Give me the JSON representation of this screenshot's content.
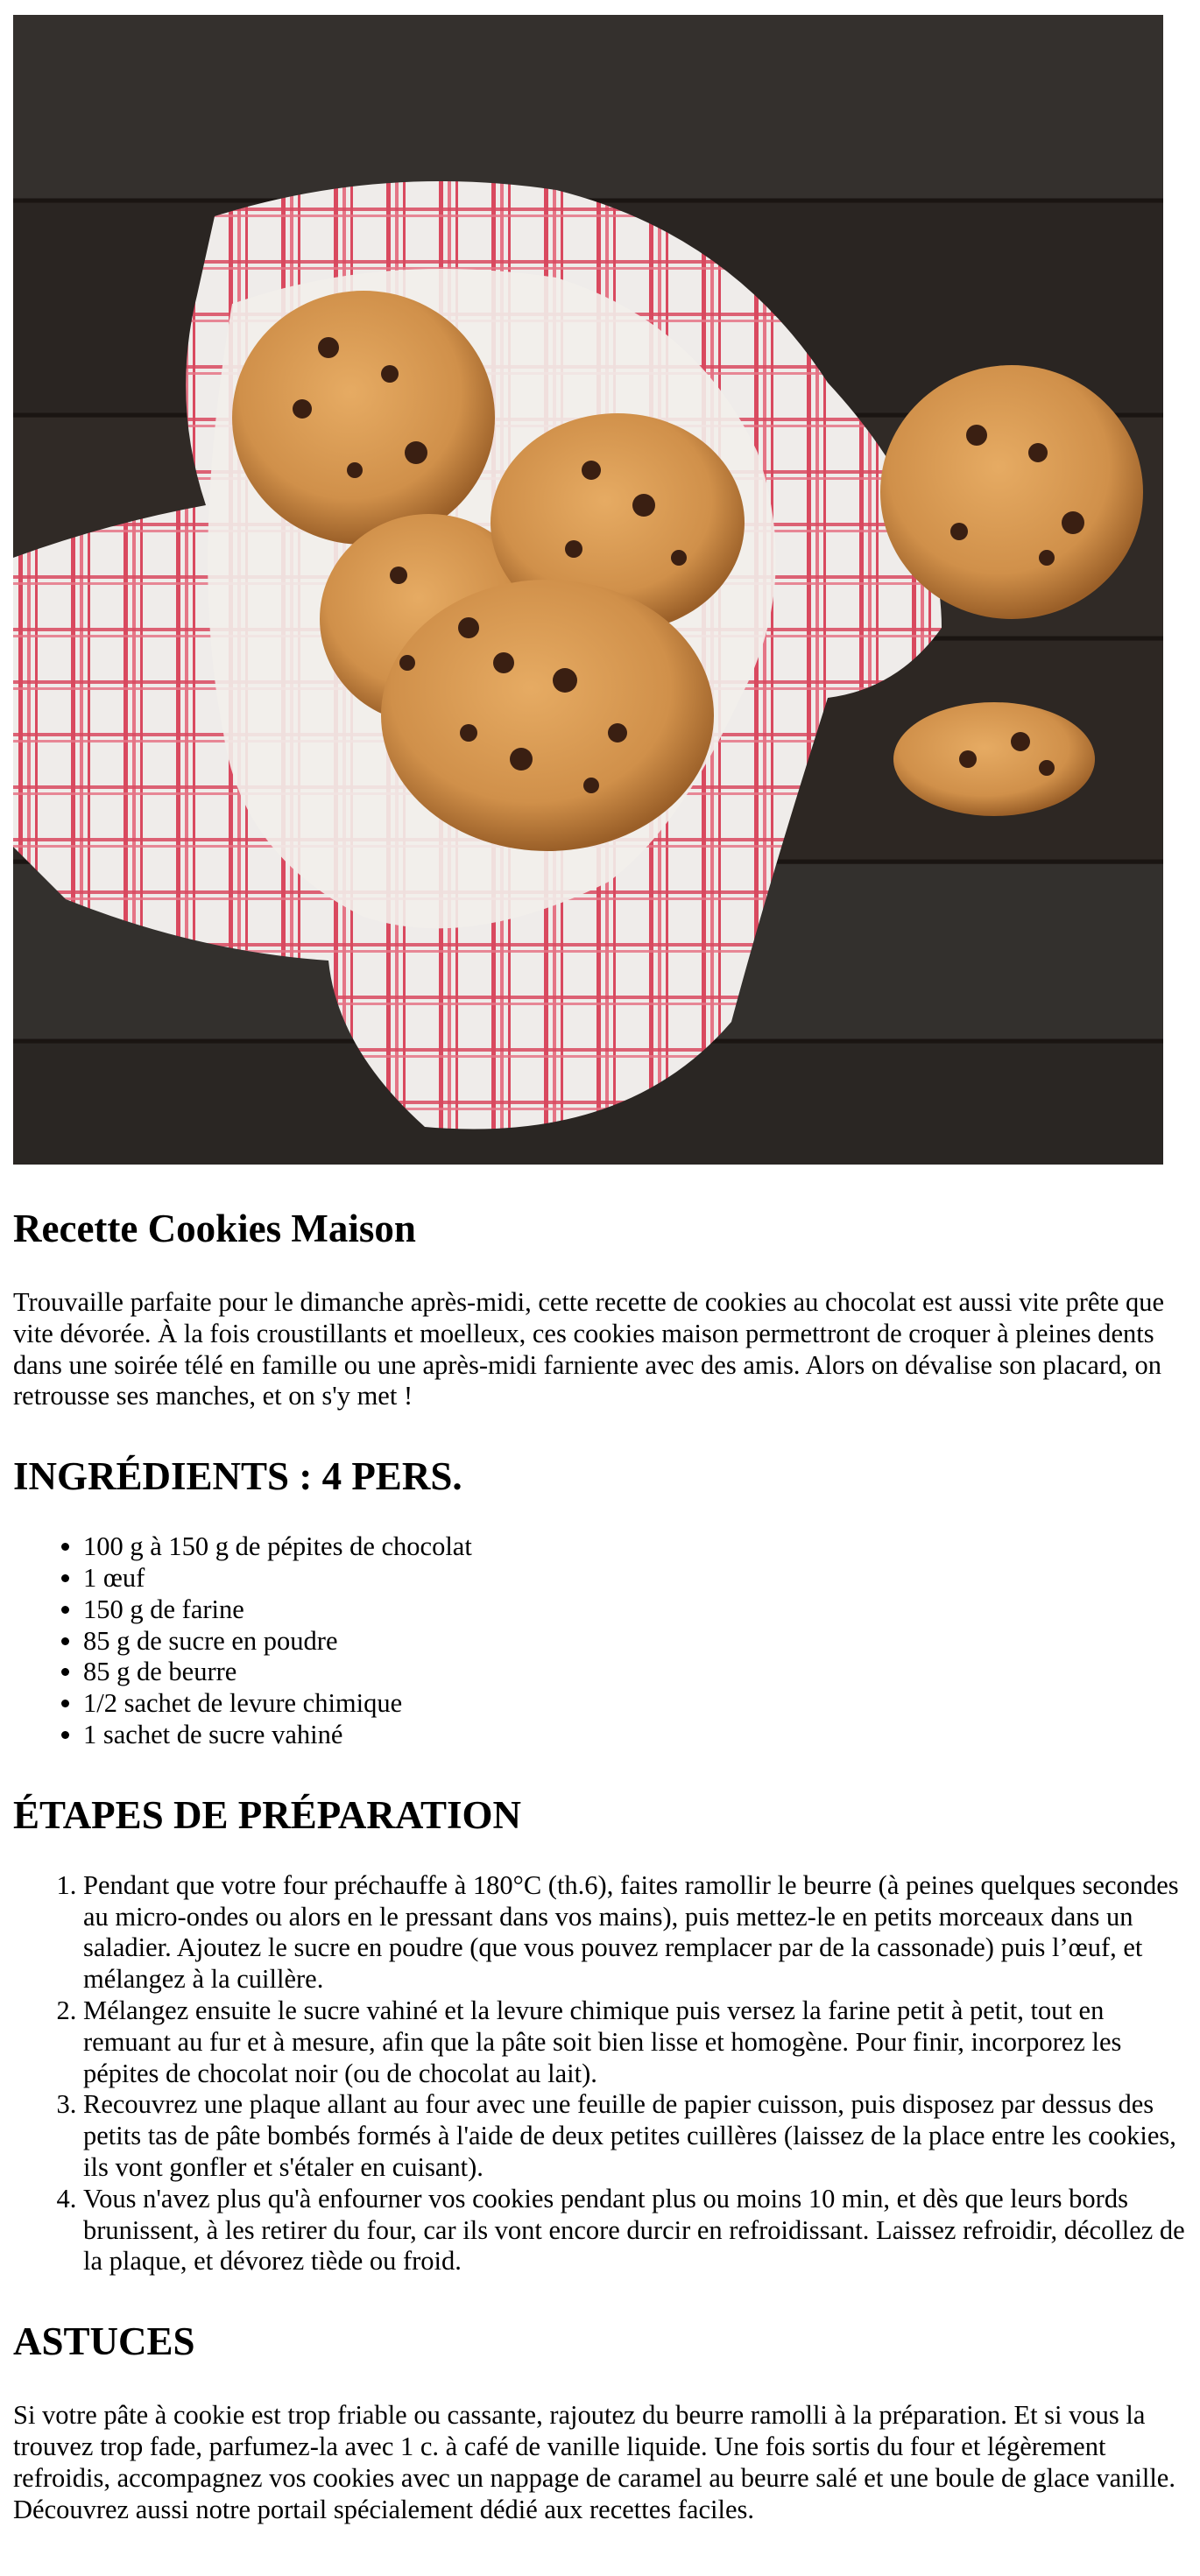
{
  "hero": {
    "alt": "Cookies aux pépites de chocolat dans un torchon rayé rouge sur une table en bois"
  },
  "recipe": {
    "title": "Recette Cookies Maison",
    "intro": "Trouvaille parfaite pour le dimanche après-midi, cette recette de cookies au chocolat est aussi vite prête que vite dévorée. À la fois croustillants et moelleux, ces cookies maison permettront de croquer à pleines dents dans une soirée télé en famille ou une après-midi farniente avec des amis. Alors on dévalise son placard, on retrousse ses manches, et on s'y met !",
    "ingredients_title": "INGRÉDIENTS : 4 PERS.",
    "ingredients": [
      "100 g à 150 g de pépites de chocolat",
      "1 œuf",
      "150 g de farine",
      "85 g de sucre en poudre",
      "85 g de beurre",
      "1/2 sachet de levure chimique",
      "1 sachet de sucre vahiné"
    ],
    "steps_title": "ÉTAPES DE PRÉPARATION",
    "steps": [
      "Pendant que votre four préchauffe à 180°C (th.6), faites ramollir le beurre (à peines quelques secondes au micro-ondes ou alors en le pressant dans vos mains), puis mettez-le en petits morceaux dans un saladier. Ajoutez le sucre en poudre (que vous pouvez remplacer par de la cassonade) puis l’œuf, et mélangez à la cuillère.",
      "Mélangez ensuite le sucre vahiné et la levure chimique puis versez la farine petit à petit, tout en remuant au fur et à mesure, afin que la pâte soit bien lisse et homogène. Pour finir, incorporez les pépites de chocolat noir (ou de chocolat au lait).",
      "Recouvrez une plaque allant au four avec une feuille de papier cuisson, puis disposez par dessus des petits tas de pâte bombés formés à l'aide de deux petites cuillères (laissez de la place entre les cookies, ils vont gonfler et s'étaler en cuisant).",
      "Vous n'avez plus qu'à enfourner vos cookies pendant plus ou moins 10 min, et dès que leurs bords brunissent, à les retirer du four, car ils vont encore durcir en refroidissant. Laissez refroidir, décollez de la plaque, et dévorez tiède ou froid."
    ],
    "tips_title": "ASTUCES",
    "tips": "Si votre pâte à cookie est trop friable ou cassante, rajoutez du beurre ramolli à la préparation. Et si vous la trouvez trop fade, parfumez-la avec 1 c. à café de vanille liquide. Une fois sortis du four et légèrement refroidis, accompagnez vos cookies avec un nappage de caramel au beurre salé et une boule de glace vanille. Découvrez aussi notre portail spécialement dédié aux recettes faciles."
  }
}
